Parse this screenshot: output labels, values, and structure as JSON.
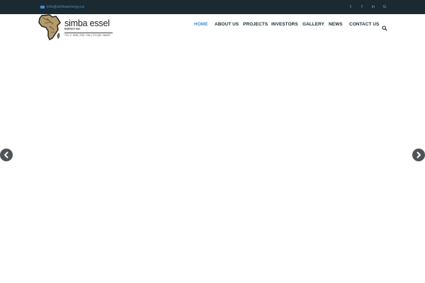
{
  "topbar": {
    "email": "info@simbaenergy.ca",
    "social": [
      {
        "icon": "twitter-icon",
        "glyph": "𝕥"
      },
      {
        "icon": "facebook-icon",
        "glyph": "f"
      },
      {
        "icon": "linkedin-icon",
        "glyph": "in"
      },
      {
        "icon": "google-icon",
        "glyph": "G"
      }
    ]
  },
  "logo": {
    "name": "simba essel",
    "subtitle": "ENERGY INC",
    "tickers": "TSX-V: SMB | FSE: G5A | OTCQB: SMAEF"
  },
  "nav": {
    "items": [
      {
        "label": "HOME",
        "active": true
      },
      {
        "label": "ABOUT US",
        "active": false
      },
      {
        "label": "PROJECTS",
        "active": false
      },
      {
        "label": "INVESTORS",
        "active": false
      },
      {
        "label": "GALLERY",
        "active": false
      },
      {
        "label": "NEWS",
        "active": false
      },
      {
        "label": "CONTACT US",
        "active": false
      }
    ]
  },
  "colors": {
    "topbar_bg": "#1b2a30",
    "accent": "#3d8fd6",
    "nav_text": "#1b2a30",
    "arrow_bg": "#4f5458"
  },
  "slider": {
    "prev_icon": "chevron-left-icon",
    "next_icon": "chevron-right-icon"
  }
}
